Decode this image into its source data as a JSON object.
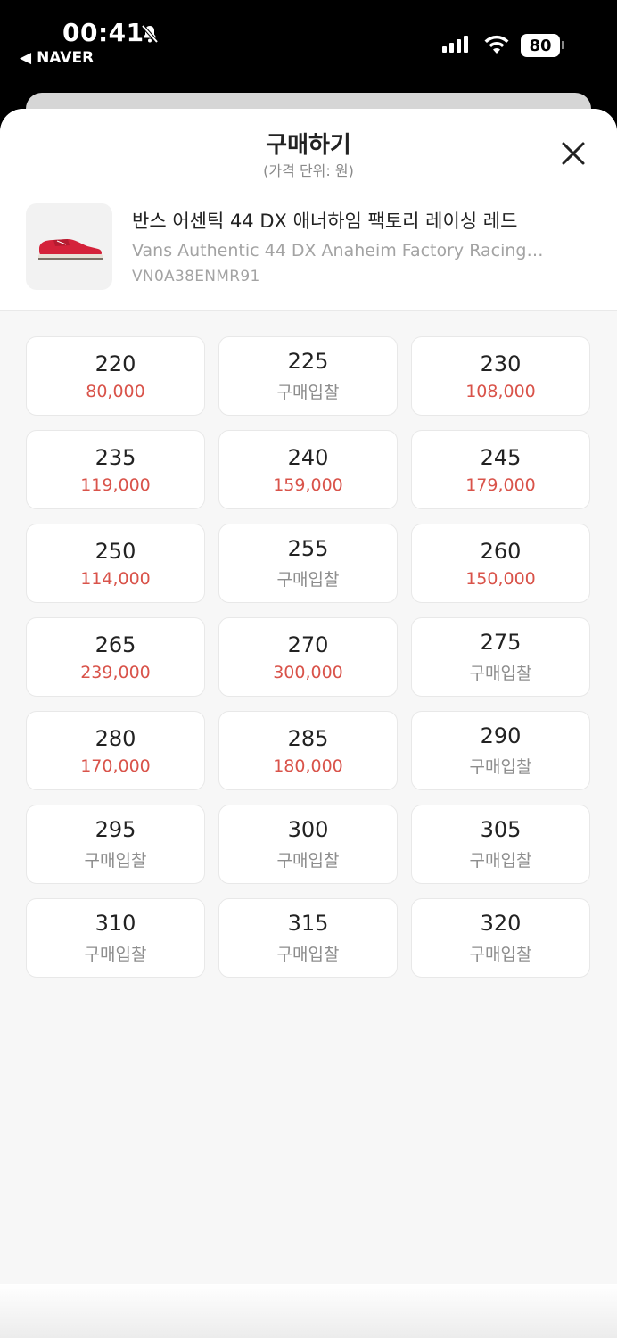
{
  "status": {
    "time": "00:41",
    "back_app": "NAVER",
    "battery": "80"
  },
  "sheet": {
    "title": "구매하기",
    "subtitle": "(가격 단위: 원)"
  },
  "product": {
    "name_ko": "반스 어센틱 44 DX 애너하임 팩토리 레이싱 레드",
    "name_en": "Vans Authentic 44 DX Anaheim Factory Racing…",
    "code": "VN0A38ENMR91"
  },
  "colors": {
    "price_red": "#d9534a",
    "bid_grey": "#8d8d8d"
  },
  "sizes": [
    {
      "size": "220",
      "price": "80,000",
      "type": "price"
    },
    {
      "size": "225",
      "price": "구매입찰",
      "type": "bid"
    },
    {
      "size": "230",
      "price": "108,000",
      "type": "price"
    },
    {
      "size": "235",
      "price": "119,000",
      "type": "price"
    },
    {
      "size": "240",
      "price": "159,000",
      "type": "price"
    },
    {
      "size": "245",
      "price": "179,000",
      "type": "price"
    },
    {
      "size": "250",
      "price": "114,000",
      "type": "price"
    },
    {
      "size": "255",
      "price": "구매입찰",
      "type": "bid"
    },
    {
      "size": "260",
      "price": "150,000",
      "type": "price"
    },
    {
      "size": "265",
      "price": "239,000",
      "type": "price"
    },
    {
      "size": "270",
      "price": "300,000",
      "type": "price"
    },
    {
      "size": "275",
      "price": "구매입찰",
      "type": "bid"
    },
    {
      "size": "280",
      "price": "170,000",
      "type": "price"
    },
    {
      "size": "285",
      "price": "180,000",
      "type": "price"
    },
    {
      "size": "290",
      "price": "구매입찰",
      "type": "bid"
    },
    {
      "size": "295",
      "price": "구매입찰",
      "type": "bid"
    },
    {
      "size": "300",
      "price": "구매입찰",
      "type": "bid"
    },
    {
      "size": "305",
      "price": "구매입찰",
      "type": "bid"
    },
    {
      "size": "310",
      "price": "구매입찰",
      "type": "bid"
    },
    {
      "size": "315",
      "price": "구매입찰",
      "type": "bid"
    },
    {
      "size": "320",
      "price": "구매입찰",
      "type": "bid"
    }
  ]
}
